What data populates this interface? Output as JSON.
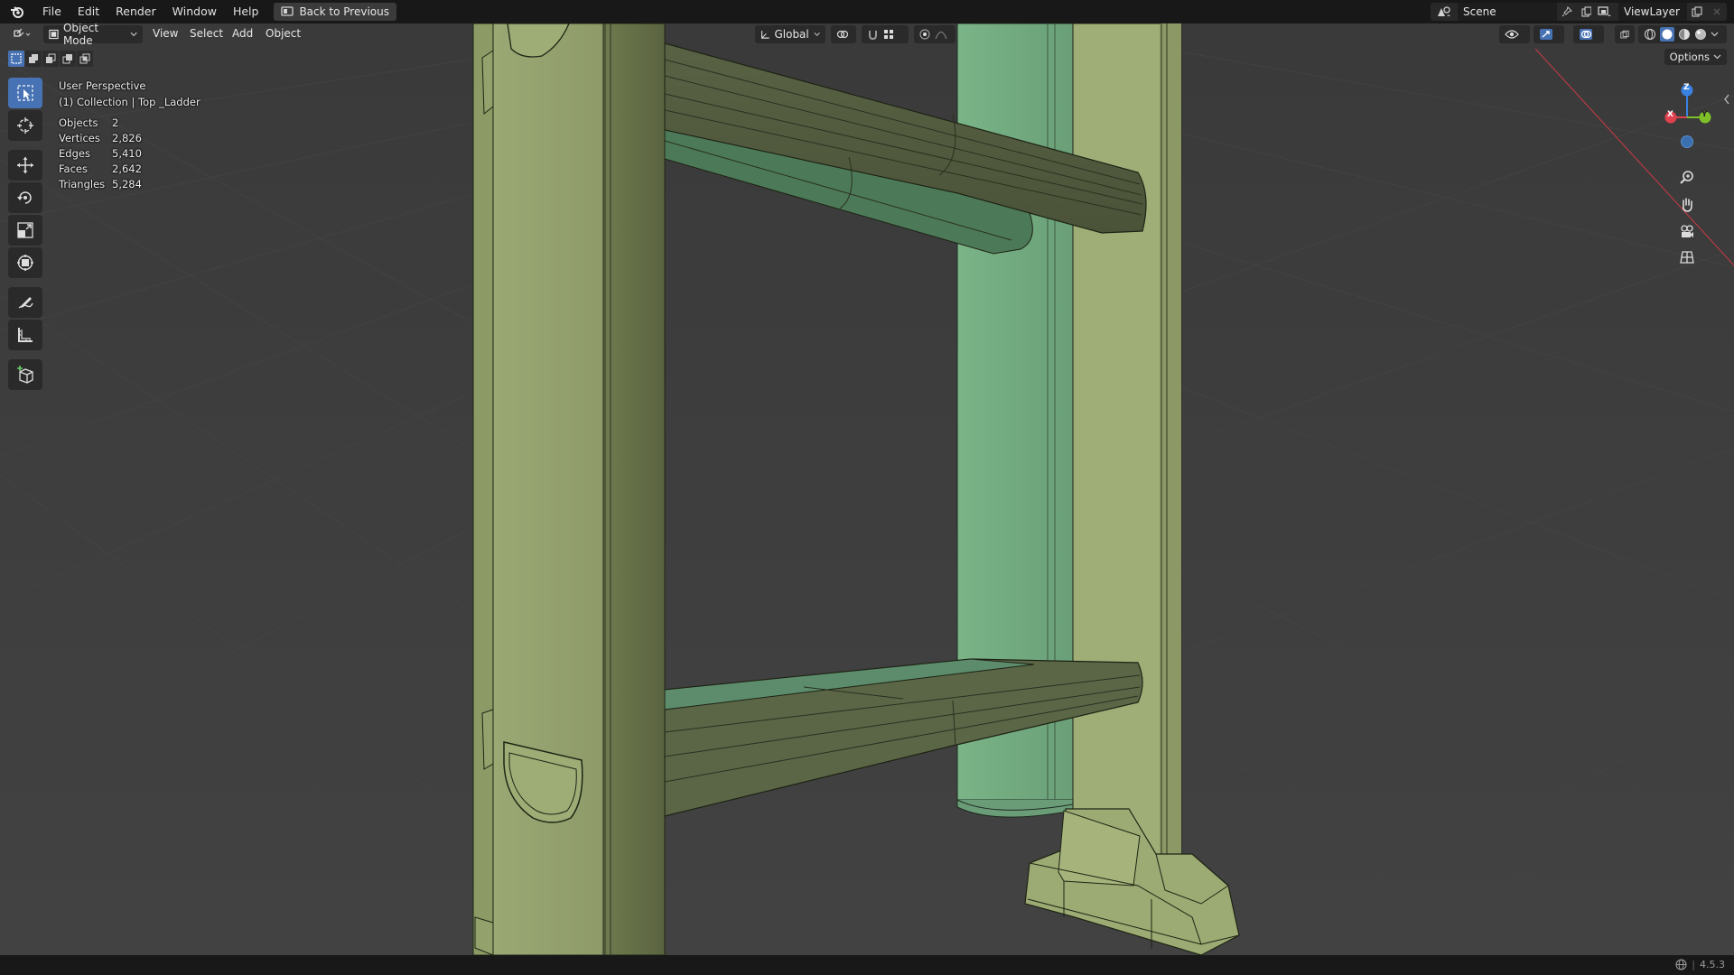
{
  "menu": {
    "file": "File",
    "edit": "Edit",
    "render": "Render",
    "window": "Window",
    "help": "Help",
    "back_to_previous": "Back to Previous"
  },
  "scene": {
    "name": "Scene"
  },
  "view_layer": {
    "name": "ViewLayer"
  },
  "viewport_header": {
    "mode": "Object Mode",
    "view": "View",
    "select": "Select",
    "add": "Add",
    "object": "Object",
    "orientation": "Global",
    "options": "Options"
  },
  "overlay": {
    "perspective": "User Perspective",
    "collection": "(1) Collection | Top _Ladder",
    "stats": [
      {
        "label": "Objects",
        "value": "2"
      },
      {
        "label": "Vertices",
        "value": "2,826"
      },
      {
        "label": "Edges",
        "value": "5,410"
      },
      {
        "label": "Faces",
        "value": "2,642"
      },
      {
        "label": "Triangles",
        "value": "5,284"
      }
    ]
  },
  "gizmo": {
    "z": "Z",
    "x": "X",
    "y": "Y"
  },
  "status": {
    "version": "4.5.3"
  },
  "colors": {
    "accent": "#4772b3",
    "mesh_olive": "#8f9d68",
    "mesh_green": "#6da27c",
    "axis_x": "#e0414f",
    "axis_y": "#7fbf2a",
    "axis_z": "#3a82e0"
  }
}
